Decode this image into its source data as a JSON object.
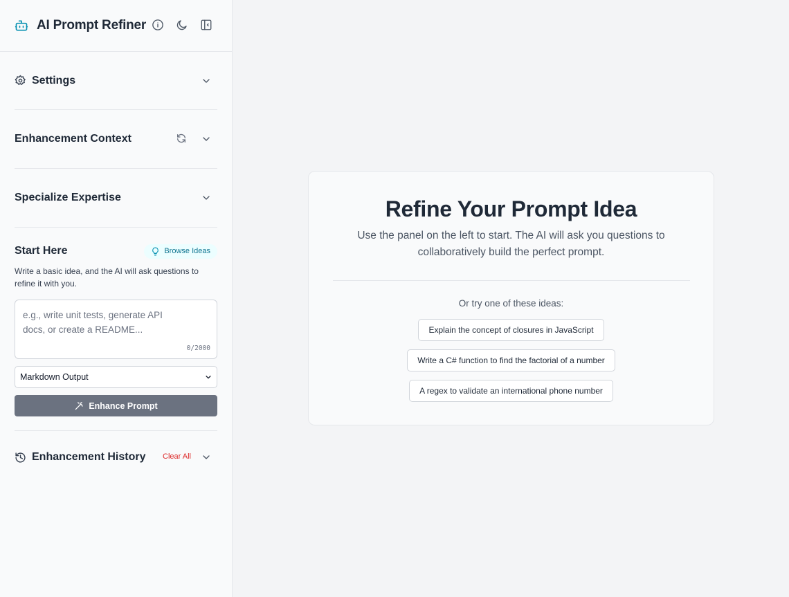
{
  "app": {
    "title": "AI Prompt Refiner"
  },
  "sections": {
    "settings": "Settings",
    "context": "Enhancement Context",
    "expertise": "Specialize Expertise"
  },
  "start": {
    "title": "Start Here",
    "browse_label": "Browse Ideas",
    "description": "Write a basic idea, and the AI will ask questions to refine it with you.",
    "placeholder": "e.g., write unit tests, generate API docs, or create a README...",
    "char_count": "0/2000",
    "format_selected": "Markdown Output",
    "enhance_label": "Enhance Prompt"
  },
  "history": {
    "title": "Enhancement History",
    "clear_label": "Clear All"
  },
  "main": {
    "title": "Refine Your Prompt Idea",
    "subtitle": "Use the panel on the left to start. The AI will ask you questions to collaboratively build the perfect prompt.",
    "ideas_label": "Or try one of these ideas:",
    "ideas": [
      "Explain the concept of closures in JavaScript",
      "Write a C# function to find the factorial of a number",
      "A regex to validate an international phone number"
    ]
  },
  "colors": {
    "accent": "#0891b2",
    "danger": "#dc2626",
    "button_disabled": "#6b7280"
  },
  "icons": {
    "brand": "bot-icon",
    "info": "info-icon",
    "theme": "moon-icon",
    "collapse": "sidebar-collapse-icon",
    "settings": "gear-icon",
    "refresh": "refresh-icon",
    "browse": "lightbulb-icon",
    "enhance": "wand-icon",
    "history": "history-icon",
    "chevron": "chevron-down-icon"
  }
}
